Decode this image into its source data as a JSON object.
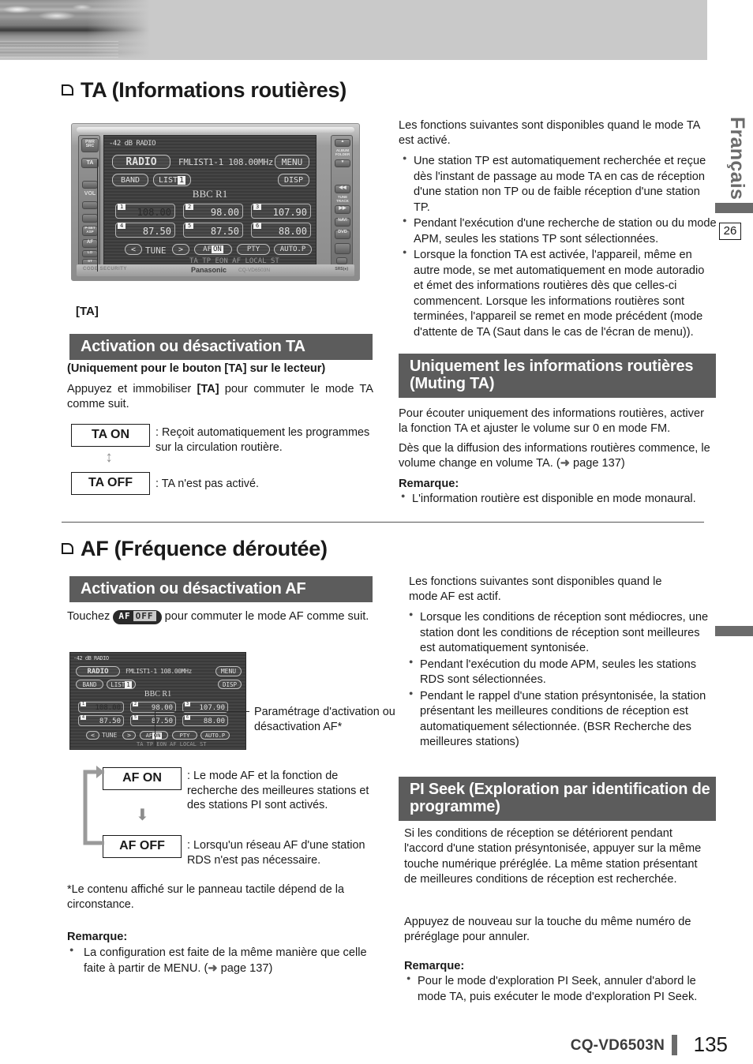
{
  "document": {
    "language_tab": "Français",
    "margin_number": "26",
    "footer_model": "CQ-VD6503N",
    "footer_page": "135"
  },
  "section_ta": {
    "title": "TA (Informations routières)",
    "figure_caption": "[TA]",
    "subhead_onoff": "Activation ou désactivation TA",
    "note_only_button": "(Uniquement pour le bouton [TA] sur le lecteur)",
    "instruction_pre": "Appuyez et immobiliser ",
    "instruction_key": "[TA]",
    "instruction_post": " pour commuter le mode TA comme suit.",
    "state_on": "TA ON",
    "state_on_desc": ": Reçoit automatiquement les pro­grammes sur la circulation routière.",
    "state_off": "TA OFF",
    "state_off_desc": ": TA n'est pas activé.",
    "intro": "Les fonctions suivantes sont disponibles quand le mode TA est activé.",
    "bullets": [
      "Une station TP est automatiquement recherchée et reçue dès l'instant de passage au mode TA en cas de réception d'une sta­tion non TP ou de faible réception d'une station TP.",
      "Pendant l'exécution d'une recherche de station ou du mode APM, seules les stations TP sont sélectionnées.",
      "Lorsque la fonction TA est activée, l'appareil, même en autre mode, se met automatiquement en mode autoradio et émet des informations routières dès que celles-ci commencent. Lorsque les informations routières sont terminées, l'appareil se remet en mode précédent (mode d'attente de TA (Saut dans le cas de l'écran de menu))."
    ]
  },
  "section_muting": {
    "subhead": "Uniquement les informations routières (Muting TA)",
    "para1": "Pour écouter uniquement des informations routières, activer la fonction TA et ajuster le volume sur 0 en mode FM.",
    "para2_pre": "Dès que la diffusion des informations routières commence, le vol­ume change en volume TA. (",
    "para2_link": "page 137",
    "para2_post": ")",
    "remarque_label": "Remarque:",
    "remarque_items": [
      "L'information routière est disponible en mode monaural."
    ]
  },
  "section_af": {
    "title": "AF (Fréquence déroutée)",
    "subhead_onoff": "Activation ou désactivation AF",
    "touch_pre": "Touchez ",
    "touch_button": "AF",
    "touch_button_state": "OFF",
    "touch_post": " pour commuter le mode AF comme suit.",
    "callout": "Paramétrage d'activation ou désactivation AF*",
    "state_on": "AF ON",
    "state_on_desc": ": Le mode AF et la fonction de recherche des meilleures stations et des stations PI sont activés.",
    "state_off": "AF OFF",
    "state_off_desc": ": Lorsqu'un réseau AF d'une sta­tion RDS n'est pas nécessaire.",
    "footnote": "*Le contenu affiché sur le panneau tactile dépend de la circonstance.",
    "remarque_label": "Remarque:",
    "remarque_pre": "La configuration est faite de la même manière que celle faite à partir de MENU. (",
    "remarque_link": "page 137",
    "remarque_post": ")",
    "intro": "Les fonctions suivantes sont disponibles quand le mode AF est actif.",
    "bullets": [
      "Lorsque les conditions de réception sont médiocres, une station dont les conditions de réception sont meilleures est automatiquement syntonisée.",
      "Pendant l'exécution du mode APM, seules les sta­tions RDS sont sélectionnées.",
      "Pendant le rappel d'une station présyntonisée, la sta­tion présentant les meilleures conditions de réception est automatiquement sélectionnée. (BSR Recherche des meilleures stations)"
    ],
    "bullet3_bold": "BSR"
  },
  "section_pi": {
    "subhead": "PI Seek (Exploration par identification de programme)",
    "para1": "Si les conditions de réception se détériorent pendant l'accord d'une station présyntonisée, appuyer sur la même touche numérique préréglée. La même station présentant de meilleures conditions de réception est recherchée.",
    "para2": "Appuyez de nouveau sur la touche du même numéro de préréglage pour annuler.",
    "remarque_label": "Remarque:",
    "remarque_items": [
      "Pour le mode d'exploration PI Seek, annuler d'abord le mode TA, puis exécuter le mode d'exploration PI Seek."
    ]
  },
  "device_display": {
    "status_top": "-42 dB  RADIO",
    "source_button": "RADIO",
    "tuner_info": "FMLIST1-1  108.00MHz",
    "menu_button": "MENU",
    "band_button": "BAND",
    "list_button": "LIST",
    "list_number": "1",
    "disp_button": "DISP",
    "station_name": "BBC  R1",
    "presets": [
      {
        "num": "1",
        "freq": "108.00",
        "selected": true
      },
      {
        "num": "2",
        "freq": "98.00",
        "selected": false
      },
      {
        "num": "3",
        "freq": "107.90",
        "selected": false
      },
      {
        "num": "4",
        "freq": "87.50",
        "selected": false
      },
      {
        "num": "5",
        "freq": "87.50",
        "selected": false
      },
      {
        "num": "6",
        "freq": "88.00",
        "selected": false
      }
    ],
    "tune_prev": "<",
    "tune_label": "TUNE",
    "tune_next": ">",
    "af_button": "AF",
    "af_state": "ON",
    "pty_button": "PTY",
    "autop_button": "AUTO.P",
    "indicators": "TA   TP EON AF   LOCAL      ST",
    "brand": "Panasonic",
    "model_small": "CQ-VD6503N",
    "code_security": "CODE SECURITY",
    "left_keys": [
      "PWR",
      "SRC",
      "TA",
      "VOL"
    ],
    "right_keys": [
      "ALBUM",
      "FOLDER",
      "TUNE",
      "TRACK",
      "NAVI",
      "DVD"
    ]
  }
}
